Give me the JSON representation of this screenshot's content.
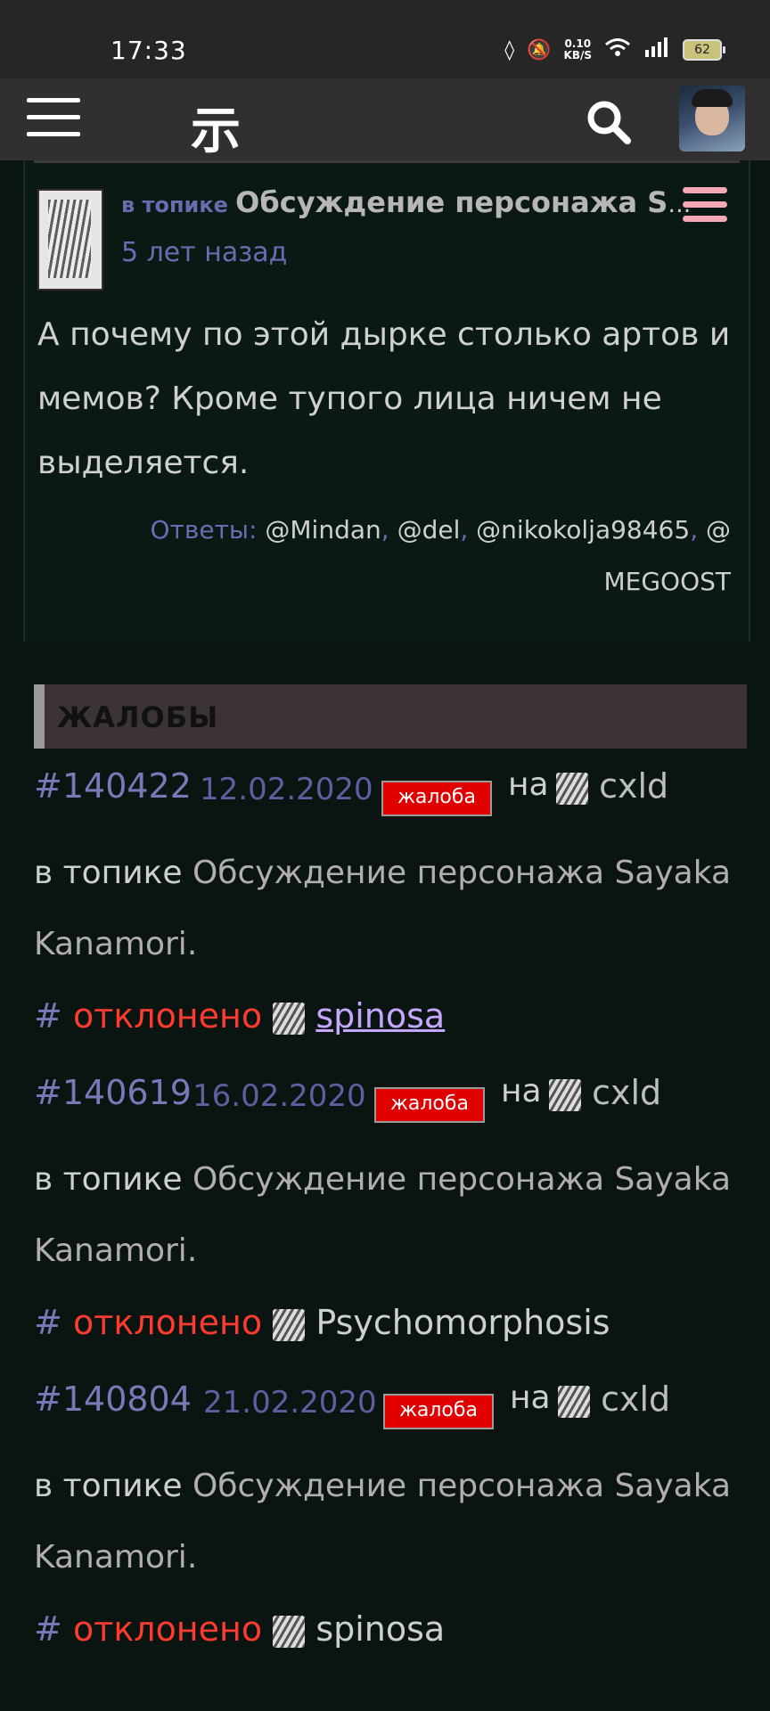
{
  "status_bar": {
    "time": "17:33",
    "net_speed_top": "0.10",
    "net_speed_unit": "KB/S",
    "battery": "62"
  },
  "nav": {
    "logo": "示"
  },
  "comment": {
    "in_topic_label": "в топике",
    "topic_title": "Обсуждение персонажа S...",
    "time_ago": "5 лет назад",
    "text": "А почему по этой дырке столько артов и мемов? Кроме тупого лица ничем не выделяется.",
    "replies_label": "Ответы:",
    "replies": [
      "@Mindan",
      "@del",
      "@nikokolja98465",
      "@ MEGOOST"
    ]
  },
  "complaints": {
    "header": "ЖАЛОБЫ",
    "badge_label": "жалоба",
    "na_label": "на",
    "in_topic_label": "в топике",
    "status_hash": "#",
    "items": [
      {
        "id": "#140422",
        "date": "12.02.2020",
        "target_user": "cxld",
        "topic": "Обсуждение персонажа Sayaka Kanamori",
        "status": "отклонено",
        "moderator": "spinosa"
      },
      {
        "id": "#140619",
        "date": "16.02.2020",
        "target_user": "cxld",
        "topic": "Обсуждение персонажа Sayaka Kanamori",
        "status": "отклонено",
        "moderator": "Psychomorphosis"
      },
      {
        "id": "#140804",
        "date": "21.02.2020",
        "target_user": "cxld",
        "topic": "Обсуждение персонажа Sayaka Kanamori",
        "status": "отклонено",
        "moderator": "spinosa"
      }
    ]
  }
}
